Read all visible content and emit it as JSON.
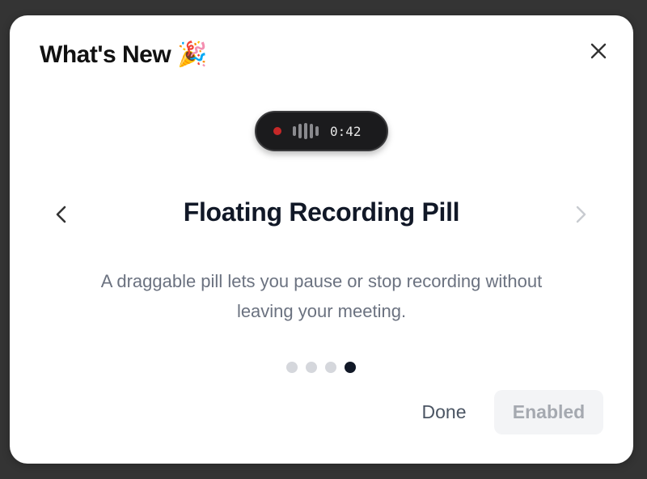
{
  "dialog": {
    "title": "What's New",
    "title_emoji": "🎉",
    "close_icon": "close-icon"
  },
  "pill": {
    "recording_indicator_color": "#c62828",
    "timer": "0:42"
  },
  "feature": {
    "title": "Floating Recording Pill",
    "description": "A draggable pill lets you pause or stop recording without leaving your meeting."
  },
  "pagination": {
    "total": 4,
    "current": 4
  },
  "actions": {
    "done_label": "Done",
    "enabled_label": "Enabled"
  },
  "colors": {
    "backdrop": "#343434",
    "active_dot": "#111827",
    "inactive_dot": "#d5d7dc"
  }
}
